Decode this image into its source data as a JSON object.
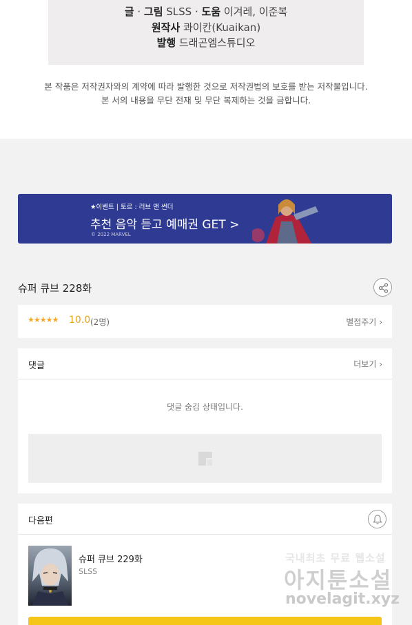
{
  "credits": {
    "line1_label1": "글",
    "line1_sep1": " · ",
    "line1_label2": "그림",
    "line1_value2": " SLSS",
    "line1_sep2": " · ",
    "line1_label3": "도움",
    "line1_value3": " 이겨레, 이준복",
    "line2_label": "원작사",
    "line2_value": " 콰이칸(Kuaikan)",
    "line3_label": "발행",
    "line3_value": " 드래곤엠스튜디오"
  },
  "copyright": {
    "line1": "본 작품은 저작권자와의 계약에 따라 발행한 것으로 저작권법의 보호를 받는 저작물입니다.",
    "line2": "본 서의 내용을 무단 전재 및 무단 복제하는 것을 금합니다."
  },
  "banner": {
    "small": "★이벤트 | 토르 : 러브 앤 썬더",
    "main": "추천 음악 듣고 예매권 GET >",
    "legal": "© 2022 MARVEL"
  },
  "episode": {
    "title": "슈퍼 큐브 228화",
    "share_icon": "share-icon"
  },
  "rating": {
    "stars": "★★★★★",
    "score": "10.0",
    "count": "(2명)",
    "rate_label": "별점주기",
    "star_color": "#f5a623"
  },
  "comments": {
    "heading": "댓글",
    "more": "더보기",
    "hidden_message": "댓글 숨김 상태입니다."
  },
  "next": {
    "heading": "다음편",
    "title": "슈퍼 큐브 229화",
    "author": "SLSS",
    "bell_icon": "bell-icon",
    "button_color": "#f5c518"
  },
  "watermark": {
    "line1_a": "국내최초 무료",
    "line1_b": " 웹소설",
    "line2": "아지툰소설",
    "line3": "novelagit.xyz"
  },
  "colors": {
    "banner_bg": "#2f3b93",
    "accent": "#e8a11c"
  }
}
